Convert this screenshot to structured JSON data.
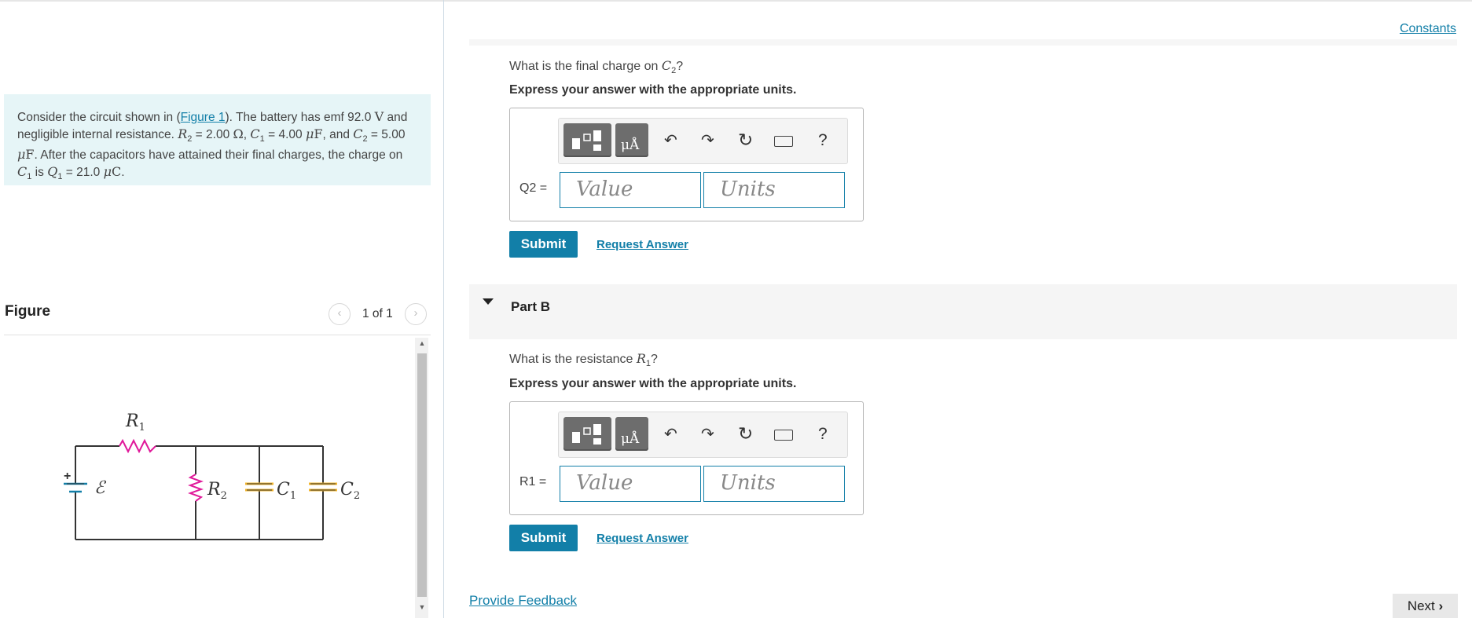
{
  "problem": {
    "link": "Figure 1",
    "emf": "92.0",
    "R2": "2.00",
    "C1": "4.00",
    "C2": "5.00",
    "Q1": "21.0"
  },
  "figure": {
    "title": "Figure",
    "pagination": "1 of 1",
    "labels": {
      "R1": "R",
      "R1_sub": "1",
      "R2": "R",
      "R2_sub": "2",
      "C1": "C",
      "C1_sub": "1",
      "C2": "C",
      "C2_sub": "2",
      "emf": "ℰ"
    }
  },
  "header": {
    "constants": "Constants"
  },
  "partA": {
    "question_prefix": "What is the final charge on",
    "question_var": "C",
    "question_sub": "2",
    "question_suffix": "?",
    "instruction": "Express your answer with the appropriate units.",
    "field_label": "Q2 =",
    "value_placeholder": "Value",
    "units_placeholder": "Units",
    "submit": "Submit",
    "request": "Request Answer"
  },
  "partB": {
    "label": "Part B",
    "question_prefix": "What is the resistance",
    "question_var": "R",
    "question_sub": "1",
    "question_suffix": "?",
    "instruction": "Express your answer with the appropriate units.",
    "field_label": "R1 =",
    "value_placeholder": "Value",
    "units_placeholder": "Units",
    "submit": "Submit",
    "request": "Request Answer"
  },
  "toolbar": {
    "units_label": "μÅ",
    "help": "?"
  },
  "footer": {
    "feedback": "Provide Feedback",
    "next": "Next"
  },
  "icons": [
    "templates-icon",
    "units-icon",
    "undo-icon",
    "redo-icon",
    "reset-icon",
    "keyboard-icon",
    "help-icon",
    "chevron-left-icon",
    "chevron-right-icon",
    "caret-down-icon"
  ],
  "colors": {
    "accent": "#127fa8",
    "problem_bg": "#e6f5f7",
    "resistor": "#e0199a",
    "capacitor": "#f2b42a"
  }
}
